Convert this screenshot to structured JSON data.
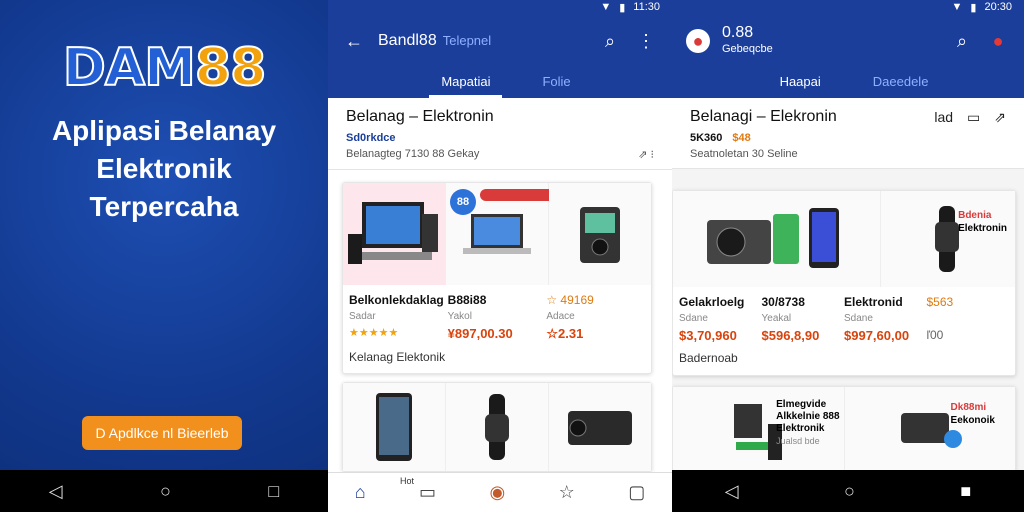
{
  "promo": {
    "logo_parts": [
      "DAM",
      "88"
    ],
    "tagline_lines": [
      "Aplipasi Belanay",
      "Elektronik",
      "Terpercaha"
    ],
    "cta_label": "D Apdlkce nl Bieerleb"
  },
  "nav_icons": [
    "back-triangle-icon",
    "home-circle-icon",
    "recents-square-icon"
  ],
  "nav_glyphs": [
    "◁",
    "○",
    "□"
  ],
  "phone1": {
    "status_time": "11:30",
    "app_title": "Bandl88",
    "app_title_sub": "Telepnel",
    "tabs": [
      "Mapatiai",
      "Folie"
    ],
    "header_title": "Belanag – Elektronin",
    "header_sub": "Sd0rkdce",
    "header_meta": "Belanagteg 7130 88 Gekay",
    "card1": {
      "badge": "88",
      "products": [
        {
          "name": "Belkonlekdaklag",
          "seller": "Sadar",
          "stars": "★★★★★",
          "price": "¥897,00.30"
        },
        {
          "name": "B88i88",
          "seller": "Yakol",
          "stars": "",
          "price": "¥897,00.30"
        },
        {
          "name": "☆ 49169",
          "seller": "Adace",
          "stars": "",
          "price": "☆2.31"
        }
      ],
      "footer": "Kelanag Elektonik"
    },
    "bottom_label": "Hot"
  },
  "phone2": {
    "status_time": "20:30",
    "app_title": "0.88",
    "app_title_sub": "Gebeqcbe",
    "tabs": [
      "Haapai",
      "Daeedele"
    ],
    "header_title": "Belanagi – Elekronin",
    "header_tag": "lad",
    "header_sub": "5K360",
    "header_sub2": "$48",
    "header_meta": "Seatnoletan 30 Seline",
    "card1": {
      "products": [
        {
          "name": "Gelakrloelg",
          "seller": "Sdane",
          "price": "$3,70,960"
        },
        {
          "name": "30/8738",
          "seller": "Yeakal",
          "price": "$596,8,90"
        },
        {
          "name": "Elektronid",
          "seller": "Sdane",
          "price": "$997,60,00"
        },
        {
          "name": "$563",
          "seller": "",
          "price": "ľ00"
        }
      ],
      "right_title": "Bdenia",
      "right_sub": "Elektronin",
      "footer": "Badernoab"
    },
    "card2": {
      "left_lines": [
        "Elmegvide",
        "Alkkelnie 888",
        "Elektronik"
      ],
      "left_sub": "Jualsd bde",
      "right_title": "Dk88mi",
      "right_sub": "Eekonoik"
    }
  },
  "colors": {
    "brand_blue": "#1b3e9a",
    "cta_orange": "#f2901d",
    "price_red": "#d9430c"
  }
}
